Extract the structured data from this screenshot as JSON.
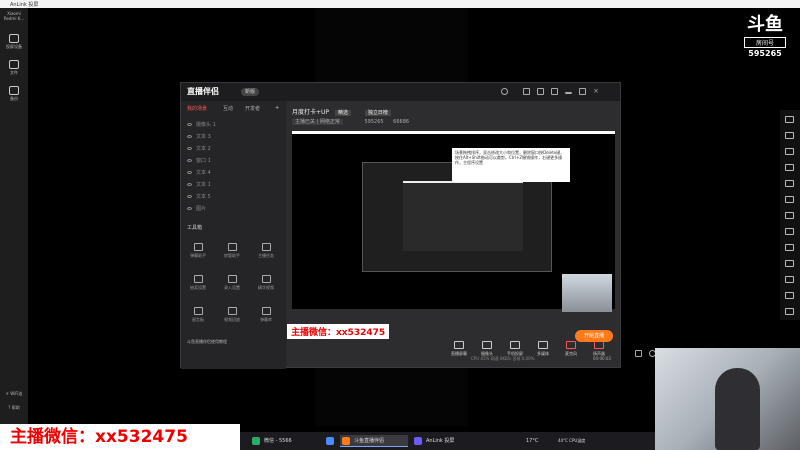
{
  "window": {
    "title": "AnLink 投屏"
  },
  "leftbar": {
    "device_name": "Xiaomi Redmi K...",
    "items": [
      {
        "label": "投屏设备",
        "icon": "phone-icon"
      },
      {
        "label": "文件",
        "icon": "file-icon"
      },
      {
        "label": "备份",
        "icon": "backup-icon"
      }
    ],
    "bottom": [
      {
        "label": "WiFi连",
        "icon": "wifi-icon"
      },
      {
        "label": "帮助",
        "icon": "help-icon"
      }
    ]
  },
  "app": {
    "logo": "直播伴侣",
    "version_badge": "新版",
    "side_tabs": [
      "我的场景",
      "互动",
      "开发者"
    ],
    "scenes": [
      "摄像头 1",
      "文本 3",
      "文本 2",
      "窗口 1",
      "文本 4",
      "文本 1",
      "文本 5",
      "图片"
    ],
    "tools_label": "工具箱",
    "tools": [
      "弹幕助手",
      "房管助手",
      "主播任务",
      "抽奖设置",
      "录入设置",
      "精华视频",
      "留言板",
      "视频回放",
      "弹幕库"
    ],
    "tool_banner": "斗鱼直播伴侣使用教程",
    "main_title": "月度打卡+UP",
    "main_badge": "精选",
    "main_tag": "独立日榜",
    "main_sub": "主播已关 | 网络正常",
    "stats": {
      "fans": "595265",
      "hot": "66686"
    },
    "wx_overlay": "主播微信：xx532475",
    "tooltip": "场景拖拽排序，双击修改大小和位置，删除窗口按Delete键，按住Alt+Shift拖动可以裁剪，Ctrl+Z撤销操作，右键更多操作，主程序设置",
    "bottom_tools": [
      "直播屏幕",
      "摄像头",
      "手机投屏",
      "多媒体",
      "麦克风",
      "扬声器"
    ],
    "start_button": "开始直播",
    "status_line": "CPU 45%  网速 0KB/s  丢帧 0.00%",
    "time": "04:00:03"
  },
  "watermark": {
    "logo": "斗鱼",
    "room_label": "房间号",
    "room_id": "595265"
  },
  "wx_banner": "主播微信：xx532475",
  "taskbar": {
    "items": [
      {
        "label": "微信 - 5566",
        "icon": "wechat-icon",
        "color": "#2aae67"
      },
      {
        "label": "斗鱼直播伴侣",
        "icon": "douyu-icon",
        "color": "#ff7a1a",
        "active": true
      },
      {
        "label": "AnLink 投屏",
        "icon": "anlink-icon",
        "color": "#6a5cff"
      }
    ],
    "weather": "17°C",
    "cpu": "44°C CPU温度"
  }
}
